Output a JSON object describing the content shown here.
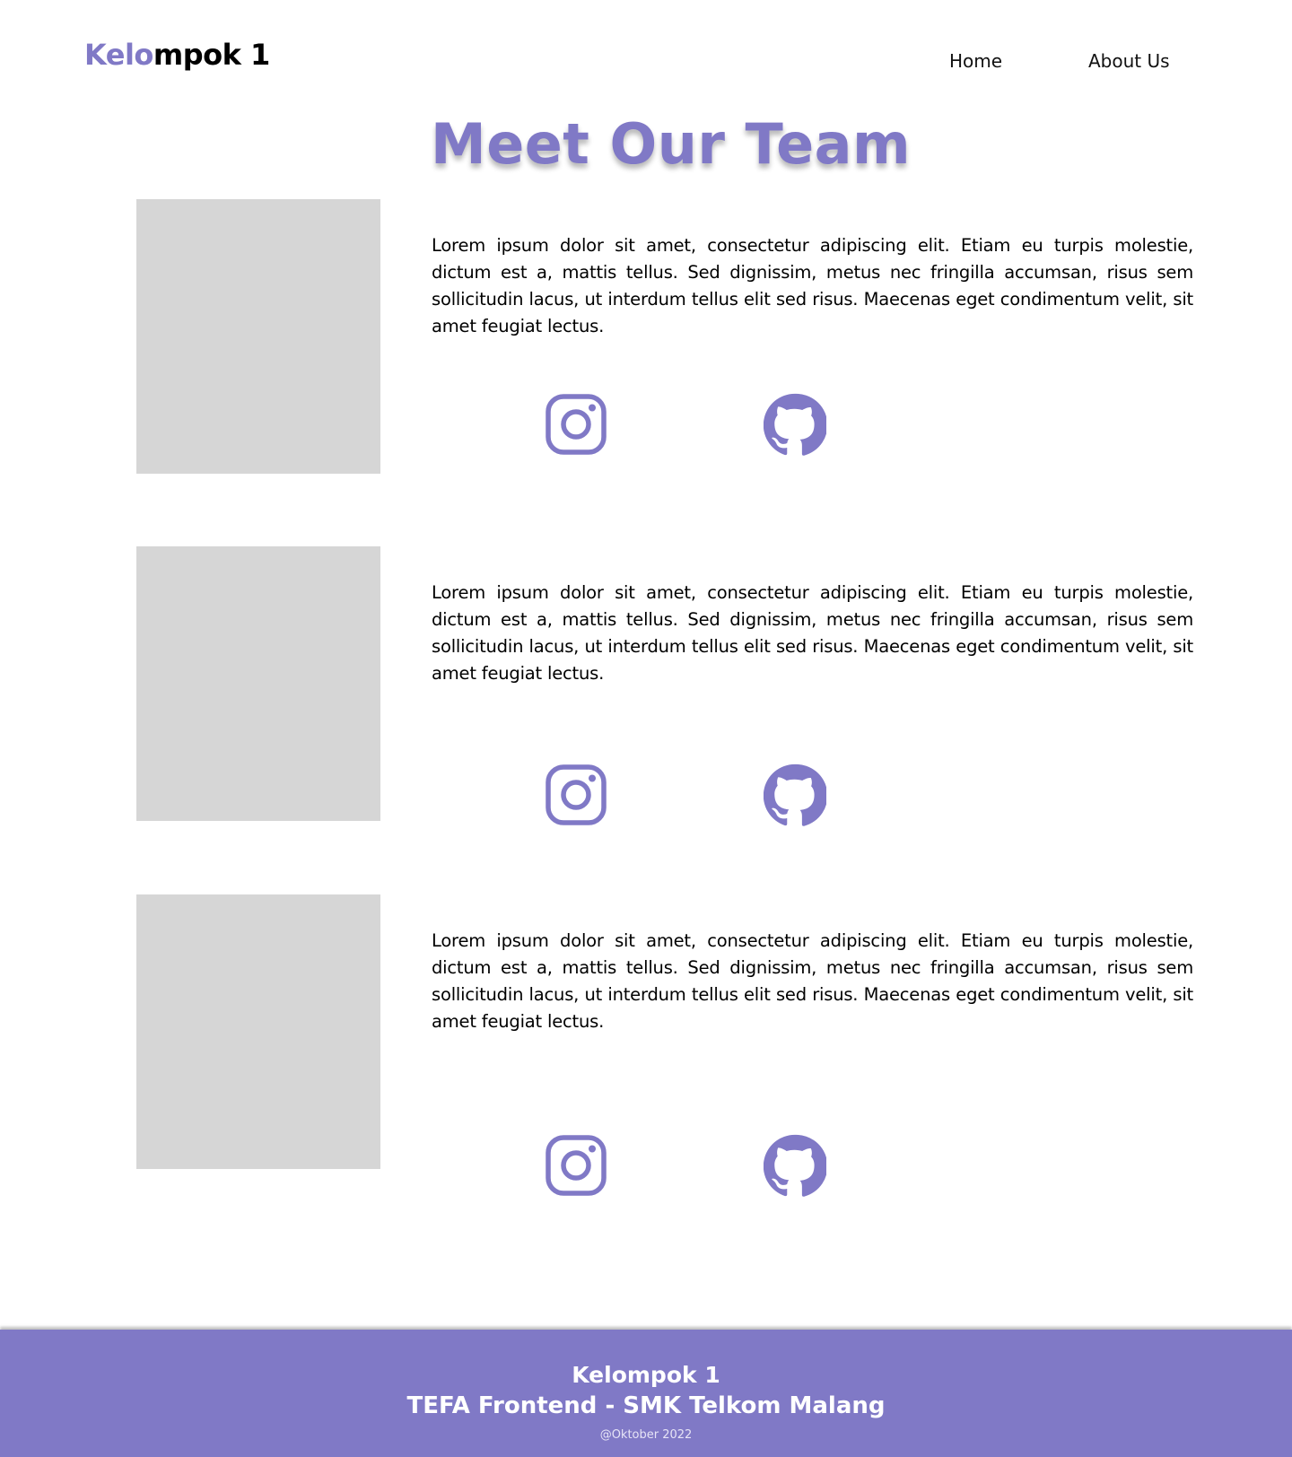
{
  "header": {
    "logo_accent": "Kelo",
    "logo_rest": "mpok 1",
    "nav": {
      "home": "Home",
      "about": "About Us"
    }
  },
  "main": {
    "title": "Meet Our Team",
    "members": [
      {
        "bio": "Lorem ipsum dolor sit amet, consectetur adipiscing elit. Etiam eu turpis molestie, dictum est a, mattis tellus. Sed dignissim, metus nec fringilla accumsan, risus sem sollicitudin lacus, ut interdum tellus elit sed risus. Maecenas eget condimentum velit, sit amet feugiat lectus."
      },
      {
        "bio": "Lorem ipsum dolor sit amet, consectetur adipiscing elit. Etiam eu turpis molestie, dictum est a, mattis tellus. Sed dignissim, metus nec fringilla accumsan, risus sem sollicitudin lacus, ut interdum tellus elit sed risus. Maecenas eget condimentum velit, sit amet feugiat lectus."
      },
      {
        "bio": "Lorem ipsum dolor sit amet, consectetur adipiscing elit. Etiam eu turpis molestie, dictum est a, mattis tellus. Sed dignissim, metus nec fringilla accumsan, risus sem sollicitudin lacus, ut interdum tellus elit sed risus. Maecenas eget condimentum velit, sit amet feugiat lectus."
      }
    ],
    "icons": {
      "instagram": "instagram-icon",
      "github": "github-icon"
    }
  },
  "footer": {
    "title": "Kelompok 1",
    "subtitle": "TEFA Frontend - SMK Telkom Malang",
    "date": "@Oktober 2022"
  },
  "colors": {
    "accent": "#8079c6",
    "placeholder": "#d6d6d6",
    "text": "#000000"
  }
}
